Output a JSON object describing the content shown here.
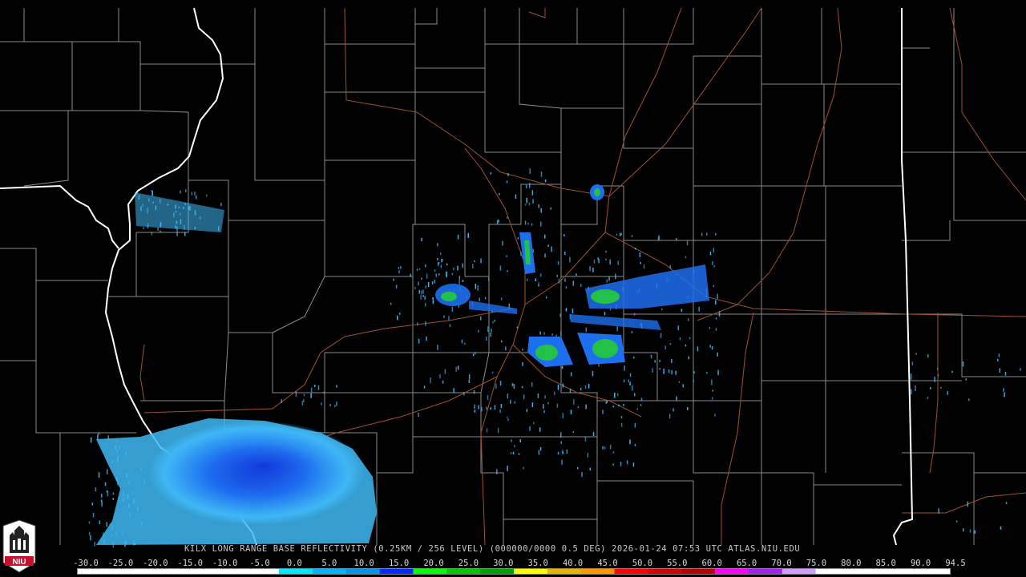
{
  "caption": {
    "station": "KILX",
    "product": "LONG RANGE BASE REFLECTIVITY",
    "resolution": "(0.25KM / 256 LEVEL)",
    "vcp": "(000000/0000",
    "tilt": "0.5 DEG)",
    "datetime": "2026-01-24 07:53 UTC",
    "source": "ATLAS.NIU.EDU"
  },
  "legend": {
    "labels": [
      "-30.0",
      "-25.0",
      "-20.0",
      "-15.0",
      "-10.0",
      "-5.0",
      "0.0",
      "5.0",
      "10.0",
      "15.0",
      "20.0",
      "25.0",
      "30.0",
      "35.0",
      "40.0",
      "45.0",
      "50.0",
      "55.0",
      "60.0",
      "65.0",
      "70.0",
      "75.0",
      "80.0",
      "85.0",
      "90.0",
      "94.5"
    ],
    "colors": [
      "#ffffff",
      "#ffffff",
      "#ffffff",
      "#ffffff",
      "#ffffff",
      "#ffffff",
      "#00e8ff",
      "#00b4ff",
      "#0096f0",
      "#0028ff",
      "#00ff00",
      "#00c800",
      "#00a000",
      "#ffff00",
      "#e6b400",
      "#ff9600",
      "#ff0000",
      "#d20000",
      "#b40000",
      "#ff00ff",
      "#a020f0",
      "#d0a0ff",
      "#ffffff",
      "#ffffff",
      "#ffffff",
      "#ffffff"
    ]
  },
  "logo": {
    "text": "NIU",
    "color": "#c8102e"
  },
  "colors": {
    "state_line": "#ffffff",
    "county_line": "#8c8c8c",
    "highway": "#a0522d",
    "echo_light": "#3fb8f5",
    "echo_mid": "#1e6ff0",
    "echo_core": "#1238d8",
    "echo_green": "#22c24a"
  }
}
